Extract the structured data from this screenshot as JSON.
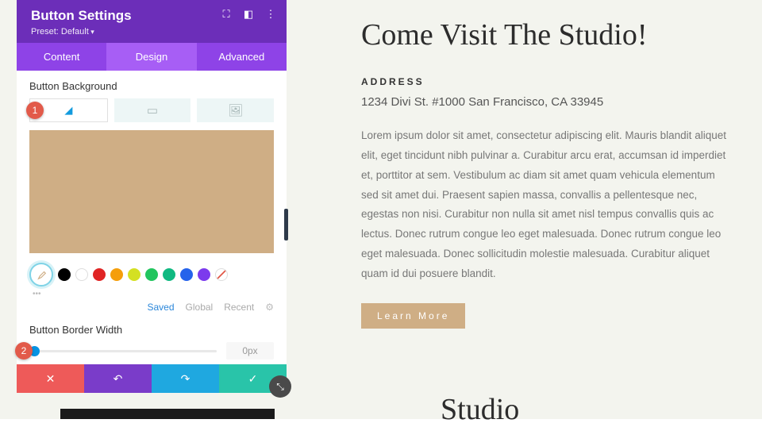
{
  "panel": {
    "title": "Button Settings",
    "preset": "Preset: Default",
    "tabs": [
      "Content",
      "Design",
      "Advanced"
    ],
    "section_bg": "Button Background",
    "callout1": "1",
    "callout2": "2",
    "swatch_color": "#cfae85",
    "palette": [
      "#000000",
      "#ffffff",
      "#e02424",
      "#f59e0b",
      "#d4e022",
      "#22c55e",
      "#10b981",
      "#2563eb",
      "#7c3aed"
    ],
    "saved_tabs": {
      "saved": "Saved",
      "global": "Global",
      "recent": "Recent"
    },
    "section_border": "Button Border Width",
    "border_val": "0px"
  },
  "content": {
    "heading": "Come Visit The Studio!",
    "addr_label": "ADDRESS",
    "addr_value": "1234 Divi St. #1000 San Francisco, CA 33945",
    "body": "Lorem ipsum dolor sit amet, consectetur adipiscing elit. Mauris blandit aliquet elit, eget tincidunt nibh pulvinar a. Curabitur arcu erat, accumsan id imperdiet et, porttitor at sem. Vestibulum ac diam sit amet quam vehicula elementum sed sit amet dui. Praesent sapien massa, convallis a pellentesque nec, egestas non nisi. Curabitur non nulla sit amet nisl tempus convallis quis ac lectus. Donec rutrum congue leo eget malesuada. Donec rutrum congue leo eget malesuada. Donec sollicitudin molestie malesuada. Curabitur aliquet quam id dui posuere blandit.",
    "button": "Learn More",
    "heading2": "Studio"
  }
}
